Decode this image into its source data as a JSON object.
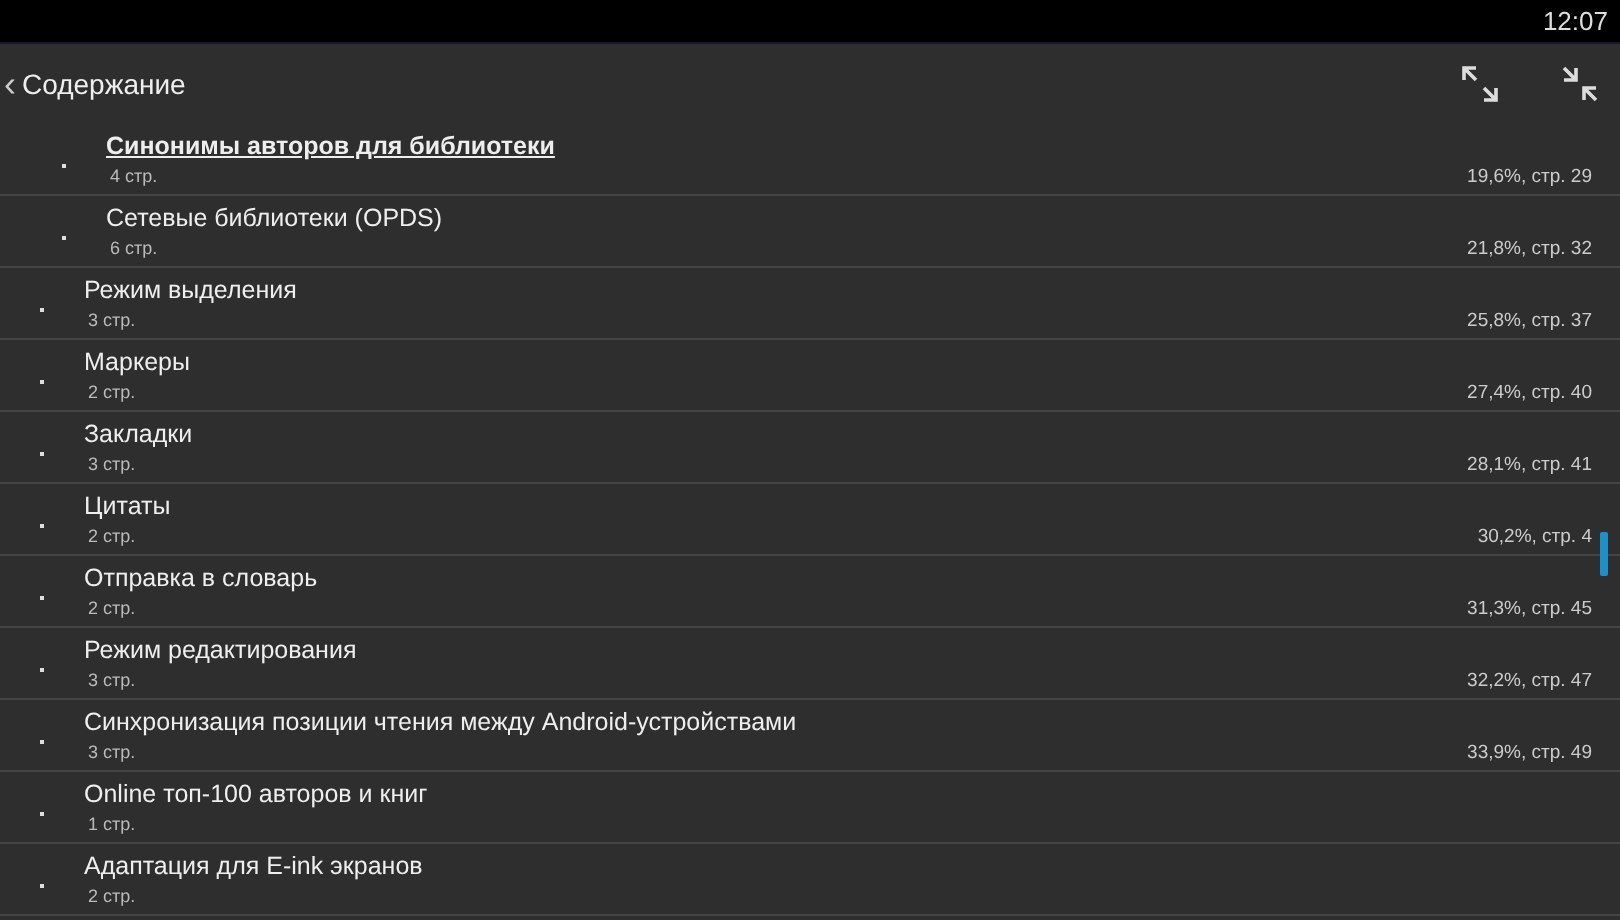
{
  "status_bar": {
    "time": "12:07"
  },
  "header": {
    "back": "‹",
    "title": "Содержание"
  },
  "toc": [
    {
      "children": [
        {
          "title": "Синонимы авторов для библиотеки",
          "pages": "4 стр.",
          "location": "19,6%, стр. 29",
          "selected": true
        },
        {
          "title": "Сетевые библиотеки (OPDS)",
          "pages": "6 стр.",
          "location": "21,8%, стр. 32",
          "selected": false
        }
      ]
    },
    {
      "title": "Режим выделения",
      "pages": "3 стр.",
      "location": "25,8%, стр. 37",
      "selected": false
    },
    {
      "title": "Маркеры",
      "pages": "2 стр.",
      "location": "27,4%, стр. 40",
      "selected": false
    },
    {
      "title": "Закладки",
      "pages": "3 стр.",
      "location": "28,1%, стр. 41",
      "selected": false
    },
    {
      "title": "Цитаты",
      "pages": "2 стр.",
      "location": "30,2%, стр. 4",
      "selected": false
    },
    {
      "title": "Отправка в словарь",
      "pages": "2 стр.",
      "location": "31,3%, стр. 45",
      "selected": false
    },
    {
      "title": "Режим редактирования",
      "pages": "3 стр.",
      "location": "32,2%, стр. 47",
      "selected": false
    },
    {
      "title": "Синхронизация позиции чтения между Android-устройствами",
      "pages": "3 стр.",
      "location": "33,9%, стр. 49",
      "selected": false
    },
    {
      "title": "Online топ-100 авторов и книг",
      "pages": "1 стр.",
      "selected": false
    },
    {
      "title": "Адаптация для E-ink экранов",
      "pages": "2 стр.",
      "selected": false
    }
  ]
}
